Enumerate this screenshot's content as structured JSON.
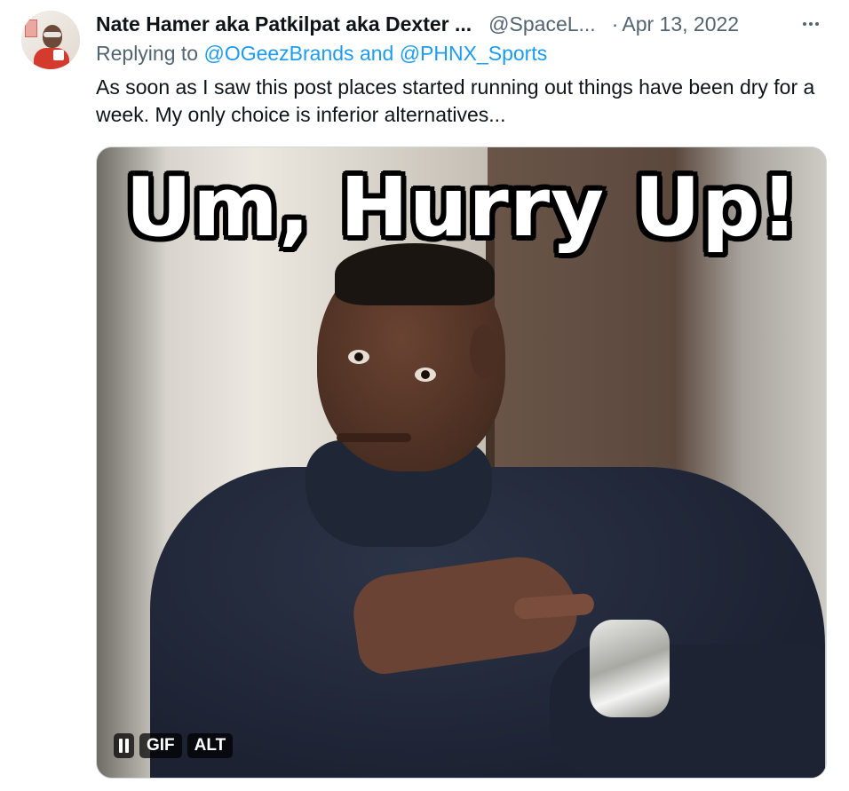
{
  "tweet": {
    "author_name": "Nate Hamer aka Patkilpat aka Dexter ...",
    "author_handle": "@SpaceL...",
    "separator": "·",
    "date": "Apr 13, 2022",
    "more_icon": "more-horizontal-icon",
    "reply_prefix": "Replying to ",
    "reply_mentions": "@OGeezBrands and @PHNX_Sports",
    "text": "As soon as I saw this post places started running out things have been dry for a week. My only choice is inferior alternatives...",
    "media": {
      "caption": "Um, Hurry Up!",
      "pause_icon": "pause-icon",
      "gif_label": "GIF",
      "alt_label": "ALT"
    }
  }
}
